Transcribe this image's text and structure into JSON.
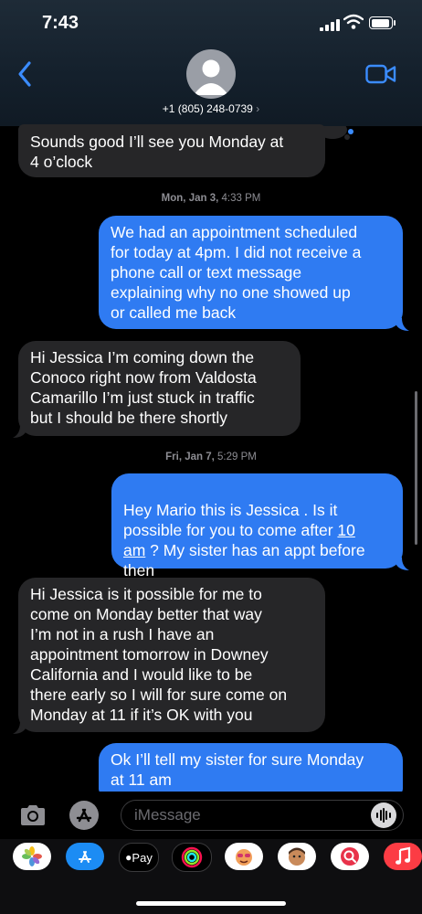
{
  "status": {
    "time": "7:43"
  },
  "header": {
    "contact": "+1 (805) 248-0739",
    "chevron": "›"
  },
  "messages": [
    {
      "type": "in",
      "text": "Sounds good I’ll see you Monday at\n4 o’clock"
    },
    {
      "type": "stamp",
      "day": "Mon, Jan 3,",
      "time": "4:33 PM"
    },
    {
      "type": "out",
      "text": "We had an appointment scheduled\nfor today at 4pm. I did not receive a\nphone call or text message\nexplaining why no one showed up\nor called me back"
    },
    {
      "type": "in",
      "text": "Hi Jessica I’m coming down the\nConoco right now from Valdosta\nCamarillo I’m just stuck in traffic\nbut I should be there shortly"
    },
    {
      "type": "stamp",
      "day": "Fri, Jan 7,",
      "time": "5:29 PM"
    },
    {
      "type": "out",
      "text_before": "Hey Mario this is Jessica . Is it\npossible for you to come after ",
      "link1": "10",
      "text_mid": "\n",
      "link2": "am",
      "text_after": " ? My sister has an appt before\nthen"
    },
    {
      "type": "in",
      "text": "Hi Jessica is it possible for me to\ncome on Monday better that way\nI’m not in a rush I have an\nappointment tomorrow in Downey\nCalifornia and I would like to be\nthere early so I will for sure come on\nMonday at 11 if it’s OK with you"
    },
    {
      "type": "out",
      "text": "Ok I’ll tell my sister for sure Monday\nat 11 am"
    }
  ],
  "input": {
    "placeholder": "iMessage"
  },
  "apps": [
    "photos-icon",
    "app-store-icon",
    "apple-pay-icon",
    "activity-icon",
    "memoji-icon",
    "memoji-icon-2",
    "web-search-icon",
    "music-icon"
  ],
  "app_labels": {
    "apple_pay": "Pay"
  },
  "colors": {
    "outgoing": "#2f7bf2",
    "incoming": "#262628",
    "accent": "#3b8cff"
  }
}
